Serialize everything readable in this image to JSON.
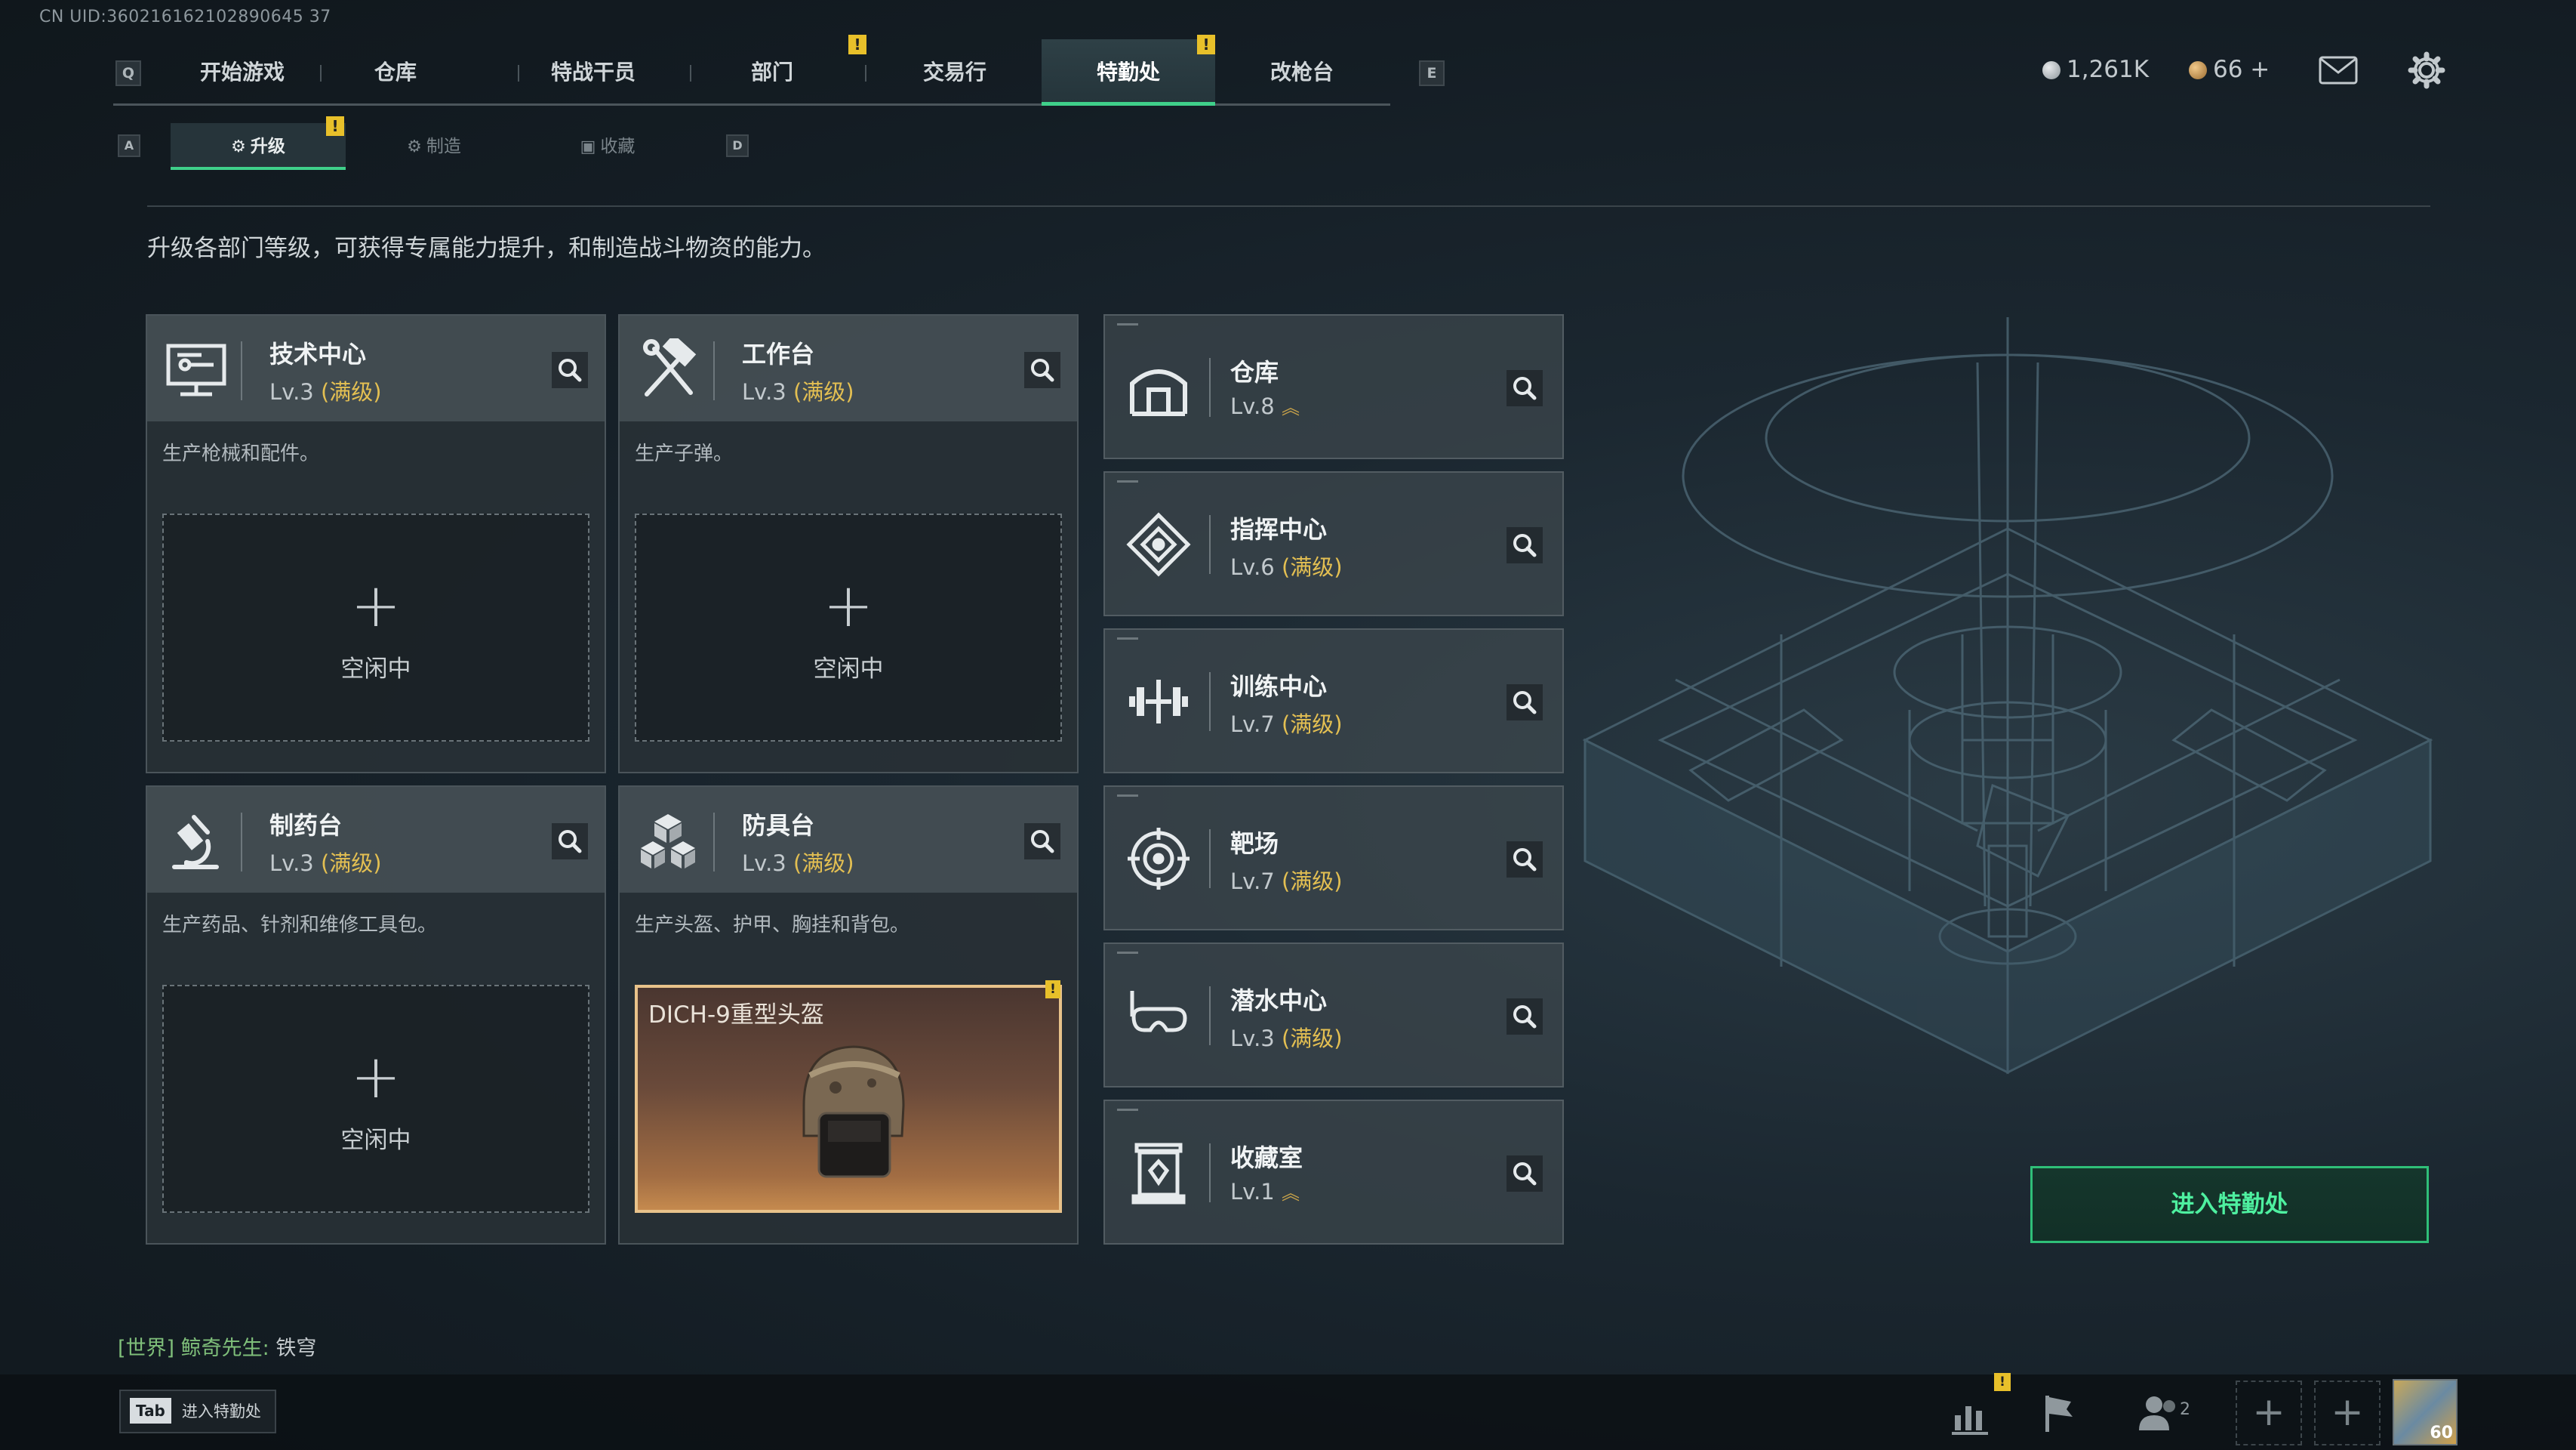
{
  "uid": "CN UID:360216162102890645 37",
  "top_nav": {
    "key_left": "Q",
    "key_right": "E",
    "tabs": [
      {
        "label": "开始游戏"
      },
      {
        "label": "仓库"
      },
      {
        "label": "特战干员"
      },
      {
        "label": "部门",
        "alert": "!"
      },
      {
        "label": "交易行"
      },
      {
        "label": "特勤处",
        "alert": "!",
        "active": true
      },
      {
        "label": "改枪台"
      }
    ]
  },
  "currency": {
    "primary": "1,261K",
    "secondary": "66 +"
  },
  "sub_nav": {
    "key_left": "A",
    "key_right": "D",
    "tabs": [
      {
        "label": "升级",
        "active": true,
        "alert": "!"
      },
      {
        "label": "制造"
      },
      {
        "label": "收藏"
      }
    ]
  },
  "description": "升级各部门等级，可获得专属能力提升，和制造战斗物资的能力。",
  "departments": [
    {
      "name": "技术中心",
      "level": "Lv.3",
      "max": "(满级)",
      "desc": "生产枪械和配件。",
      "slot_plus": "+",
      "slot_status": "空闲中",
      "icon": "tech-center-icon"
    },
    {
      "name": "工作台",
      "level": "Lv.3",
      "max": "(满级)",
      "desc": "生产子弹。",
      "slot_plus": "+",
      "slot_status": "空闲中",
      "icon": "workbench-icon"
    },
    {
      "name": "制药台",
      "level": "Lv.3",
      "max": "(满级)",
      "desc": "生产药品、针剂和维修工具包。",
      "slot_plus": "+",
      "slot_status": "空闲中",
      "icon": "pharmacy-icon"
    },
    {
      "name": "防具台",
      "level": "Lv.3",
      "max": "(满级)",
      "desc": "生产头盔、护甲、胸挂和背包。",
      "item_name": "DICH-9重型头盔",
      "item_alert": "!",
      "icon": "armor-bench-icon"
    }
  ],
  "facilities": [
    {
      "name": "仓库",
      "level": "Lv.8",
      "max": "",
      "icon": "warehouse-icon"
    },
    {
      "name": "指挥中心",
      "level": "Lv.6",
      "max": "(满级)",
      "icon": "command-center-icon"
    },
    {
      "name": "训练中心",
      "level": "Lv.7",
      "max": "(满级)",
      "icon": "training-center-icon"
    },
    {
      "name": "靶场",
      "level": "Lv.7",
      "max": "(满级)",
      "icon": "shooting-range-icon"
    },
    {
      "name": "潜水中心",
      "level": "Lv.3",
      "max": "(满级)",
      "icon": "diving-center-icon"
    },
    {
      "name": "收藏室",
      "level": "Lv.1",
      "max": "",
      "icon": "collection-room-icon"
    }
  ],
  "enter_button": "进入特勤处",
  "chat": {
    "channel": "[世界]",
    "nick": "鲸奇先生:",
    "message": "铁穹"
  },
  "bottom": {
    "tab_key": "Tab",
    "tab_label": "进入特勤处",
    "friends_count": "2",
    "avatar_level": "60"
  },
  "colors": {
    "accent_green": "#3fd08a",
    "max_gold": "#e3bf52",
    "alert_yellow": "#e8c02a"
  }
}
